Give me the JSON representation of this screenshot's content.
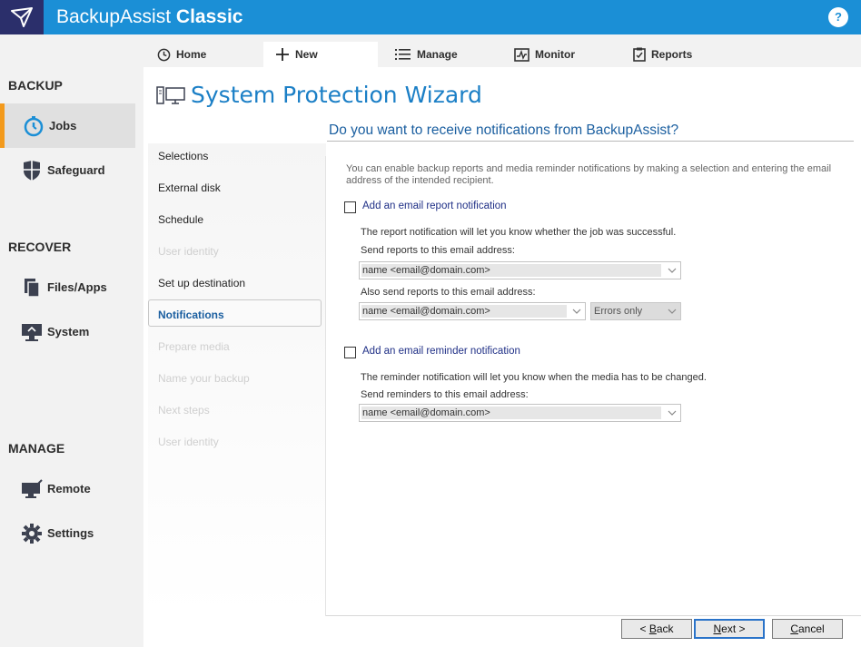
{
  "app": {
    "name_light": "BackupAssist",
    "name_bold": "Classic",
    "help": "?"
  },
  "sidebar": {
    "sections": {
      "backup": "BACKUP",
      "recover": "RECOVER",
      "manage": "MANAGE"
    },
    "items": [
      {
        "label": "Jobs",
        "icon": "stopwatch-icon",
        "active": true
      },
      {
        "label": "Safeguard",
        "icon": "shield-icon"
      },
      {
        "label": "Files/Apps",
        "icon": "files-icon"
      },
      {
        "label": "System",
        "icon": "monitor-icon"
      },
      {
        "label": "Remote",
        "icon": "remote-icon"
      },
      {
        "label": "Settings",
        "icon": "gear-icon"
      }
    ]
  },
  "tabs": [
    {
      "label": "Home",
      "icon": "clock-icon"
    },
    {
      "label": "New",
      "icon": "plus-icon",
      "active": true
    },
    {
      "label": "Manage",
      "icon": "list-icon"
    },
    {
      "label": "Monitor",
      "icon": "pulse-icon"
    },
    {
      "label": "Reports",
      "icon": "clipboard-icon"
    }
  ],
  "wizard": {
    "title": "System Protection Wizard",
    "steps": [
      {
        "label": "Selections",
        "state": "done"
      },
      {
        "label": "External disk",
        "state": "done"
      },
      {
        "label": "Schedule",
        "state": "done"
      },
      {
        "label": "User identity",
        "state": "disabled"
      },
      {
        "label": "Set up destination",
        "state": "done"
      },
      {
        "label": "Notifications",
        "state": "active"
      },
      {
        "label": "Prepare media",
        "state": "disabled"
      },
      {
        "label": "Name your backup",
        "state": "disabled"
      },
      {
        "label": "Next steps",
        "state": "disabled"
      },
      {
        "label": "User identity",
        "state": "disabled"
      }
    ]
  },
  "page": {
    "question": "Do you want to receive notifications from BackupAssist?",
    "intro": "You can enable backup reports and media reminder notifications by making a selection and entering the email address of the intended recipient.",
    "report": {
      "checkbox_label": "Add an email report notification",
      "checked": false,
      "desc": "The report notification will let you know whether the job was successful.",
      "send_label": "Send reports to this email address:",
      "send_value": "name <email@domain.com>",
      "also_label": "Also send reports to this email address:",
      "also_value": "name <email@domain.com>",
      "filter_value": "Errors only"
    },
    "reminder": {
      "checkbox_label": "Add an email reminder notification",
      "checked": false,
      "desc": "The reminder notification will let you know when the media has to be changed.",
      "send_label": "Send reminders to this email address:",
      "send_value": "name <email@domain.com>"
    }
  },
  "buttons": {
    "back_prefix": "< ",
    "back_ul": "B",
    "back_rest": "ack",
    "next_ul": "N",
    "next_rest": "ext >",
    "cancel_ul": "C",
    "cancel_rest": "ancel"
  },
  "colors": {
    "titlebar": "#1b8fd6",
    "logo_bg": "#2b2f6b",
    "accent": "#f39a1c",
    "link": "#1b5fa0"
  }
}
